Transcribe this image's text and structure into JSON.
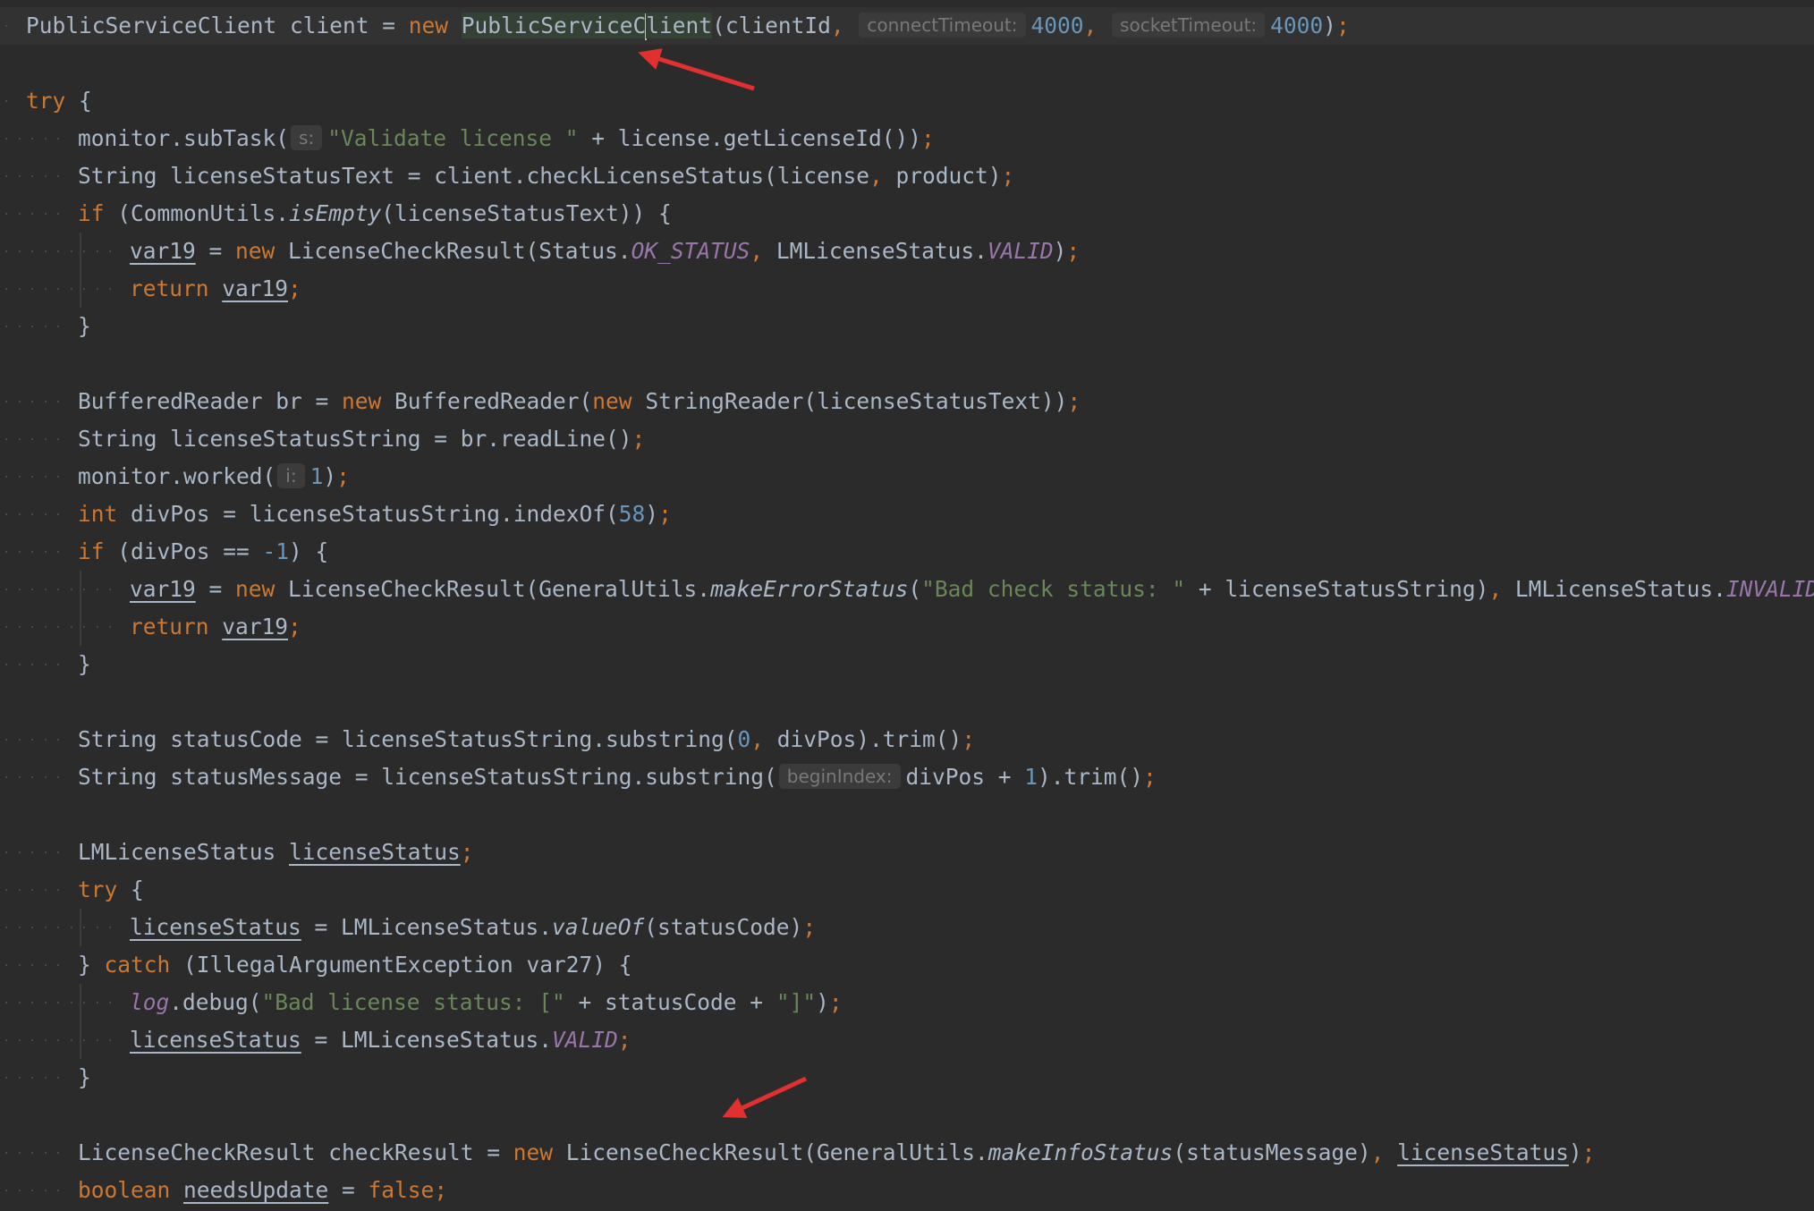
{
  "editor": {
    "language": "java",
    "theme_colors": {
      "background": "#2b2b2b",
      "text": "#a9b7c6",
      "keyword": "#cc7832",
      "string": "#6a8759",
      "number": "#6897bb",
      "constant": "#9876aa",
      "hint": "#787878",
      "annotation_arrow": "#e03030"
    },
    "caret": {
      "line": 1,
      "symbol": "PublicServiceClient"
    },
    "annotations": [
      {
        "type": "red-arrow",
        "points_to": "PublicServiceClient"
      },
      {
        "type": "red-arrow",
        "points_to": "LicenseCheckResult"
      }
    ],
    "lines": [
      {
        "indent": 0,
        "current": true,
        "tokens": [
          {
            "t": "PublicServiceClient client = "
          },
          {
            "t": "new ",
            "c": "kw"
          },
          {
            "t": "PublicServiceC",
            "c": "hl"
          },
          {
            "c": "caret"
          },
          {
            "t": "lient",
            "c": "hl"
          },
          {
            "t": "(clientId"
          },
          {
            "t": ", ",
            "c": "kw"
          },
          {
            "t": "connectTimeout:",
            "c": "hint"
          },
          {
            "t": "4000",
            "c": "num"
          },
          {
            "t": ", ",
            "c": "kw"
          },
          {
            "t": "socketTimeout:",
            "c": "hint"
          },
          {
            "t": "4000",
            "c": "num"
          },
          {
            "t": ")"
          },
          {
            "t": ";",
            "c": "kw"
          }
        ]
      },
      {
        "indent": 0,
        "tokens": []
      },
      {
        "indent": 0,
        "tokens": [
          {
            "t": "try ",
            "c": "kw"
          },
          {
            "t": "{"
          }
        ]
      },
      {
        "indent": 1,
        "tokens": [
          {
            "t": "monitor.subTask("
          },
          {
            "t": "s:",
            "c": "hint"
          },
          {
            "t": "\"Validate license \"",
            "c": "str"
          },
          {
            "t": " + license.getLicenseId())"
          },
          {
            "t": ";",
            "c": "kw"
          }
        ]
      },
      {
        "indent": 1,
        "tokens": [
          {
            "t": "String licenseStatusText = client.checkLicenseStatus(license"
          },
          {
            "t": ", ",
            "c": "kw"
          },
          {
            "t": "product)"
          },
          {
            "t": ";",
            "c": "kw"
          }
        ]
      },
      {
        "indent": 1,
        "tokens": [
          {
            "t": "if ",
            "c": "kw"
          },
          {
            "t": "(CommonUtils."
          },
          {
            "t": "isEmpty",
            "c": "method"
          },
          {
            "t": "(licenseStatusText)) {"
          }
        ]
      },
      {
        "indent": 2,
        "tokens": [
          {
            "t": "var19",
            "c": "uvar"
          },
          {
            "t": " = "
          },
          {
            "t": "new ",
            "c": "kw"
          },
          {
            "t": "LicenseCheckResult(Status."
          },
          {
            "t": "OK_STATUS",
            "c": "const"
          },
          {
            "t": ", ",
            "c": "kw"
          },
          {
            "t": "LMLicenseStatus."
          },
          {
            "t": "VALID",
            "c": "const"
          },
          {
            "t": ")"
          },
          {
            "t": ";",
            "c": "kw"
          }
        ]
      },
      {
        "indent": 2,
        "tokens": [
          {
            "t": "return ",
            "c": "kw"
          },
          {
            "t": "var19",
            "c": "uvar"
          },
          {
            "t": ";",
            "c": "kw"
          }
        ]
      },
      {
        "indent": 1,
        "tokens": [
          {
            "t": "}"
          }
        ]
      },
      {
        "indent": 0,
        "tokens": []
      },
      {
        "indent": 1,
        "tokens": [
          {
            "t": "BufferedReader br = "
          },
          {
            "t": "new ",
            "c": "kw"
          },
          {
            "t": "BufferedReader("
          },
          {
            "t": "new ",
            "c": "kw"
          },
          {
            "t": "StringReader(licenseStatusText))"
          },
          {
            "t": ";",
            "c": "kw"
          }
        ]
      },
      {
        "indent": 1,
        "tokens": [
          {
            "t": "String licenseStatusString = br.readLine()"
          },
          {
            "t": ";",
            "c": "kw"
          }
        ]
      },
      {
        "indent": 1,
        "tokens": [
          {
            "t": "monitor.worked("
          },
          {
            "t": "i:",
            "c": "hint"
          },
          {
            "t": "1",
            "c": "num"
          },
          {
            "t": ")"
          },
          {
            "t": ";",
            "c": "kw"
          }
        ]
      },
      {
        "indent": 1,
        "tokens": [
          {
            "t": "int ",
            "c": "kw"
          },
          {
            "t": "divPos = licenseStatusString.indexOf("
          },
          {
            "t": "58",
            "c": "num"
          },
          {
            "t": ")"
          },
          {
            "t": ";",
            "c": "kw"
          }
        ]
      },
      {
        "indent": 1,
        "tokens": [
          {
            "t": "if ",
            "c": "kw"
          },
          {
            "t": "(divPos == "
          },
          {
            "t": "-1",
            "c": "num"
          },
          {
            "t": ") {"
          }
        ]
      },
      {
        "indent": 2,
        "tokens": [
          {
            "t": "var19",
            "c": "uvar"
          },
          {
            "t": " = "
          },
          {
            "t": "new ",
            "c": "kw"
          },
          {
            "t": "LicenseCheckResult(GeneralUtils."
          },
          {
            "t": "makeErrorStatus",
            "c": "method"
          },
          {
            "t": "("
          },
          {
            "t": "\"Bad check status: \"",
            "c": "str"
          },
          {
            "t": " + licenseStatusString)"
          },
          {
            "t": ", ",
            "c": "kw"
          },
          {
            "t": "LMLicenseStatus."
          },
          {
            "t": "INVALID",
            "c": "const"
          },
          {
            "t": ")"
          },
          {
            "t": ";",
            "c": "kw"
          }
        ]
      },
      {
        "indent": 2,
        "tokens": [
          {
            "t": "return ",
            "c": "kw"
          },
          {
            "t": "var19",
            "c": "uvar"
          },
          {
            "t": ";",
            "c": "kw"
          }
        ]
      },
      {
        "indent": 1,
        "tokens": [
          {
            "t": "}"
          }
        ]
      },
      {
        "indent": 0,
        "tokens": []
      },
      {
        "indent": 1,
        "tokens": [
          {
            "t": "String statusCode = licenseStatusString.substring("
          },
          {
            "t": "0",
            "c": "num"
          },
          {
            "t": ", ",
            "c": "kw"
          },
          {
            "t": "divPos).trim()"
          },
          {
            "t": ";",
            "c": "kw"
          }
        ]
      },
      {
        "indent": 1,
        "tokens": [
          {
            "t": "String statusMessage = licenseStatusString.substring("
          },
          {
            "t": "beginIndex:",
            "c": "hint"
          },
          {
            "t": "divPos + "
          },
          {
            "t": "1",
            "c": "num"
          },
          {
            "t": ").trim()"
          },
          {
            "t": ";",
            "c": "kw"
          }
        ]
      },
      {
        "indent": 0,
        "tokens": []
      },
      {
        "indent": 1,
        "tokens": [
          {
            "t": "LMLicenseStatus "
          },
          {
            "t": "licenseStatus",
            "c": "uvar"
          },
          {
            "t": ";",
            "c": "kw"
          }
        ]
      },
      {
        "indent": 1,
        "tokens": [
          {
            "t": "try ",
            "c": "kw"
          },
          {
            "t": "{"
          }
        ]
      },
      {
        "indent": 2,
        "tokens": [
          {
            "t": "licenseStatus",
            "c": "uvar"
          },
          {
            "t": " = LMLicenseStatus."
          },
          {
            "t": "valueOf",
            "c": "method"
          },
          {
            "t": "(statusCode)"
          },
          {
            "t": ";",
            "c": "kw"
          }
        ]
      },
      {
        "indent": 1,
        "tokens": [
          {
            "t": "} "
          },
          {
            "t": "catch ",
            "c": "kw"
          },
          {
            "t": "(IllegalArgumentException var27) {"
          }
        ]
      },
      {
        "indent": 2,
        "tokens": [
          {
            "t": "log",
            "c": "field"
          },
          {
            "t": ".debug("
          },
          {
            "t": "\"Bad license status: [\"",
            "c": "str"
          },
          {
            "t": " + statusCode + "
          },
          {
            "t": "\"]\"",
            "c": "str"
          },
          {
            "t": ")"
          },
          {
            "t": ";",
            "c": "kw"
          }
        ]
      },
      {
        "indent": 2,
        "tokens": [
          {
            "t": "licenseStatus",
            "c": "uvar"
          },
          {
            "t": " = LMLicenseStatus."
          },
          {
            "t": "VALID",
            "c": "const"
          },
          {
            "t": ";",
            "c": "kw"
          }
        ]
      },
      {
        "indent": 1,
        "tokens": [
          {
            "t": "}"
          }
        ]
      },
      {
        "indent": 0,
        "tokens": []
      },
      {
        "indent": 1,
        "tokens": [
          {
            "t": "LicenseCheckResult checkResult = "
          },
          {
            "t": "new ",
            "c": "kw"
          },
          {
            "t": "LicenseCheckResult(GeneralUtils."
          },
          {
            "t": "makeInfoStatus",
            "c": "method"
          },
          {
            "t": "(statusMessage)"
          },
          {
            "t": ", ",
            "c": "kw"
          },
          {
            "t": "licenseStatus",
            "c": "uvar"
          },
          {
            "t": ")"
          },
          {
            "t": ";",
            "c": "kw"
          }
        ]
      },
      {
        "indent": 1,
        "tokens": [
          {
            "t": "boolean ",
            "c": "kw"
          },
          {
            "t": "needsUpdate",
            "c": "uvar"
          },
          {
            "t": " = "
          },
          {
            "t": "false",
            "c": "kw"
          },
          {
            "t": ";",
            "c": "kw"
          }
        ]
      }
    ]
  }
}
